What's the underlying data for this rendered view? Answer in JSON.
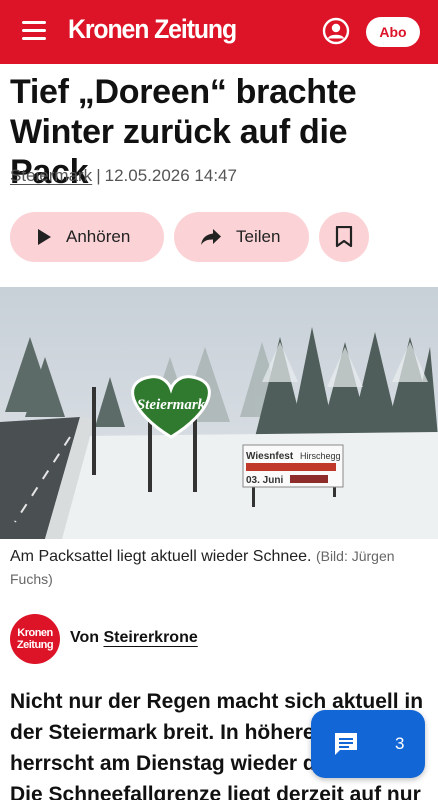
{
  "header": {
    "logo_text": "Kronen Zeitung",
    "abo_label": "Abo",
    "brand_color": "#dd1327",
    "icons": [
      "menu-icon",
      "account-icon"
    ]
  },
  "article": {
    "headline": "Tief „Doreen“ brachte Winter zurück auf die Pack",
    "category": "Steiermark",
    "separator": "|",
    "datetime": "12.05.2026 14:47",
    "actions": {
      "listen_label": "Anhören",
      "share_label": "Teilen",
      "bookmark_icon": "bookmark-icon"
    },
    "image": {
      "caption": "Am Packsattel liegt aktuell wieder Schnee.",
      "credit": "(Bild: Jürgen Fuchs)",
      "sign_heart_text": "Steiermark",
      "sign_board_title": "Wiesnfest",
      "sign_board_place": "Hirschegg",
      "sign_board_date": "03. Juni"
    },
    "author": {
      "logo_line1": "Kronen",
      "logo_line2": "Zeitung",
      "prefix": "Von",
      "name": "Steirerkrone"
    },
    "lead_lines": [
      "Nicht nur der Regen macht sich aktuell in",
      "der Steiermark breit. In höheren Lagen",
      "herrscht am Dienstag wieder der Winter.",
      "Die Schneefallgrenze liegt derzeit auf nur"
    ]
  },
  "comments": {
    "count": "3",
    "icon": "comment-icon",
    "color": "#1366d6"
  }
}
